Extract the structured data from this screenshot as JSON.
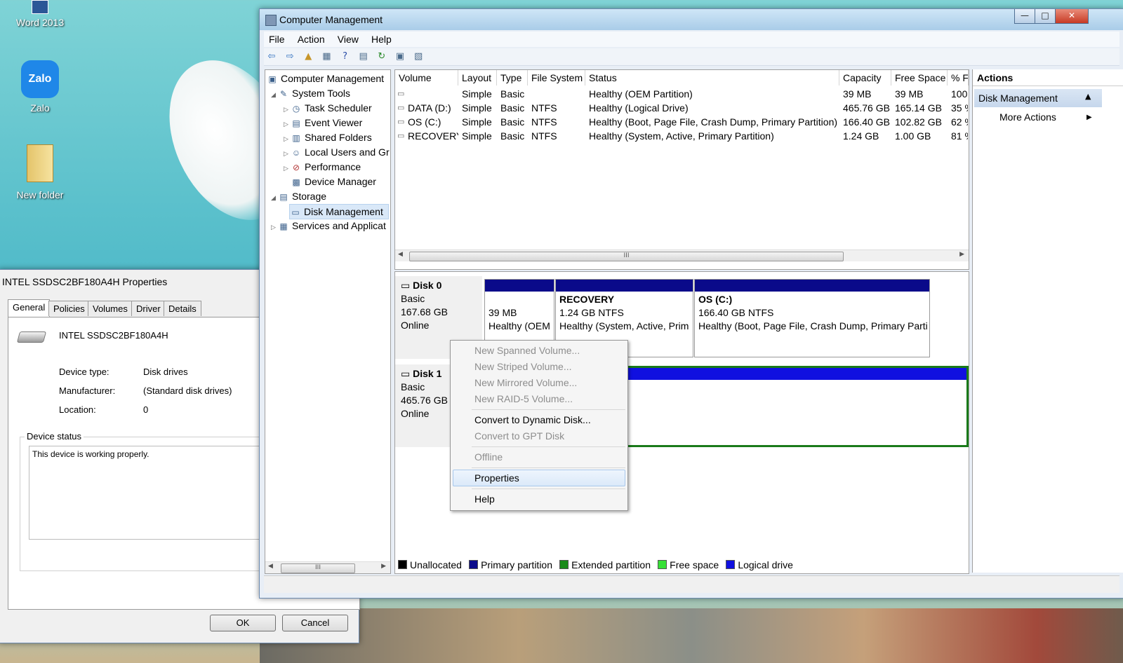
{
  "desktop": {
    "icons": [
      {
        "label": "Word 2013"
      },
      {
        "label": "Zalo",
        "glyph": "Zalo"
      },
      {
        "label": "New folder"
      }
    ]
  },
  "props_window": {
    "title": "INTEL SSDSC2BF180A4H Properties",
    "tabs": [
      "General",
      "Policies",
      "Volumes",
      "Driver",
      "Details"
    ],
    "device_name": "INTEL SSDSC2BF180A4H",
    "fields": [
      {
        "label": "Device type:",
        "value": "Disk drives"
      },
      {
        "label": "Manufacturer:",
        "value": "(Standard disk drives)"
      },
      {
        "label": "Location:",
        "value": "0"
      }
    ],
    "status_group": "Device status",
    "status_text": "This device is working properly.",
    "ok": "OK",
    "cancel": "Cancel"
  },
  "cm_window": {
    "title": "Computer Management",
    "controls": {
      "minimize": "—",
      "maximize": "□",
      "close": "✕"
    },
    "menu": [
      "File",
      "Action",
      "View",
      "Help"
    ],
    "tree": [
      {
        "label": "Computer Management",
        "icon": "computer-icon"
      },
      {
        "label": "System Tools",
        "icon": "tools-icon"
      },
      {
        "label": "Task Scheduler",
        "icon": "clock-icon"
      },
      {
        "label": "Event Viewer",
        "icon": "event-icon"
      },
      {
        "label": "Shared Folders",
        "icon": "shared-folder-icon"
      },
      {
        "label": "Local Users and Gr",
        "icon": "users-icon"
      },
      {
        "label": "Performance",
        "icon": "performance-icon"
      },
      {
        "label": "Device Manager",
        "icon": "device-manager-icon"
      },
      {
        "label": "Storage",
        "icon": "storage-icon"
      },
      {
        "label": "Disk Management",
        "icon": "disk-icon"
      },
      {
        "label": "Services and Applicat",
        "icon": "services-icon"
      }
    ],
    "table": {
      "headers": [
        "Volume",
        "Layout",
        "Type",
        "File System",
        "Status",
        "Capacity",
        "Free Space",
        "% Fr"
      ],
      "rows": [
        [
          "",
          "Simple",
          "Basic",
          "",
          "Healthy (OEM Partition)",
          "39 MB",
          "39 MB",
          "100"
        ],
        [
          "DATA (D:)",
          "Simple",
          "Basic",
          "NTFS",
          "Healthy (Logical Drive)",
          "465.76 GB",
          "165.14 GB",
          "35 %"
        ],
        [
          "OS (C:)",
          "Simple",
          "Basic",
          "NTFS",
          "Healthy (Boot, Page File, Crash Dump, Primary Partition)",
          "166.40 GB",
          "102.82 GB",
          "62 %"
        ],
        [
          "RECOVERY",
          "Simple",
          "Basic",
          "NTFS",
          "Healthy (System, Active, Primary Partition)",
          "1.24 GB",
          "1.00 GB",
          "81 %"
        ]
      ]
    },
    "disks": [
      {
        "name": "Disk 0",
        "type": "Basic",
        "size": "167.68 GB",
        "state": "Online",
        "partitions": [
          {
            "name": "",
            "size": "39 MB",
            "status": "Healthy (OEM"
          },
          {
            "name": "RECOVERY",
            "size": "1.24 GB NTFS",
            "status": "Healthy (System, Active, Prim"
          },
          {
            "name": "OS  (C:)",
            "size": "166.40 GB NTFS",
            "status": "Healthy (Boot, Page File, Crash Dump, Primary Parti"
          }
        ]
      },
      {
        "name": "Disk 1",
        "type": "Basic",
        "size": "465.76 GB",
        "state": "Online"
      }
    ],
    "context_menu": {
      "items": [
        "New Spanned Volume...",
        "New Striped Volume...",
        "New Mirrored Volume...",
        "New RAID-5 Volume...",
        "Convert to Dynamic Disk...",
        "Convert to GPT Disk",
        "Offline",
        "Properties",
        "Help"
      ],
      "selected": "Properties"
    },
    "legend": [
      {
        "label": "Unallocated",
        "color": "#000000"
      },
      {
        "label": "Primary partition",
        "color": "#0a0a8a"
      },
      {
        "label": "Extended partition",
        "color": "#1a8a1a"
      },
      {
        "label": "Free space",
        "color": "#36e036"
      },
      {
        "label": "Logical drive",
        "color": "#1010e0"
      }
    ],
    "actions": {
      "header": "Actions",
      "section": "Disk Management",
      "more": "More Actions"
    },
    "scroll_glyph": "III"
  }
}
